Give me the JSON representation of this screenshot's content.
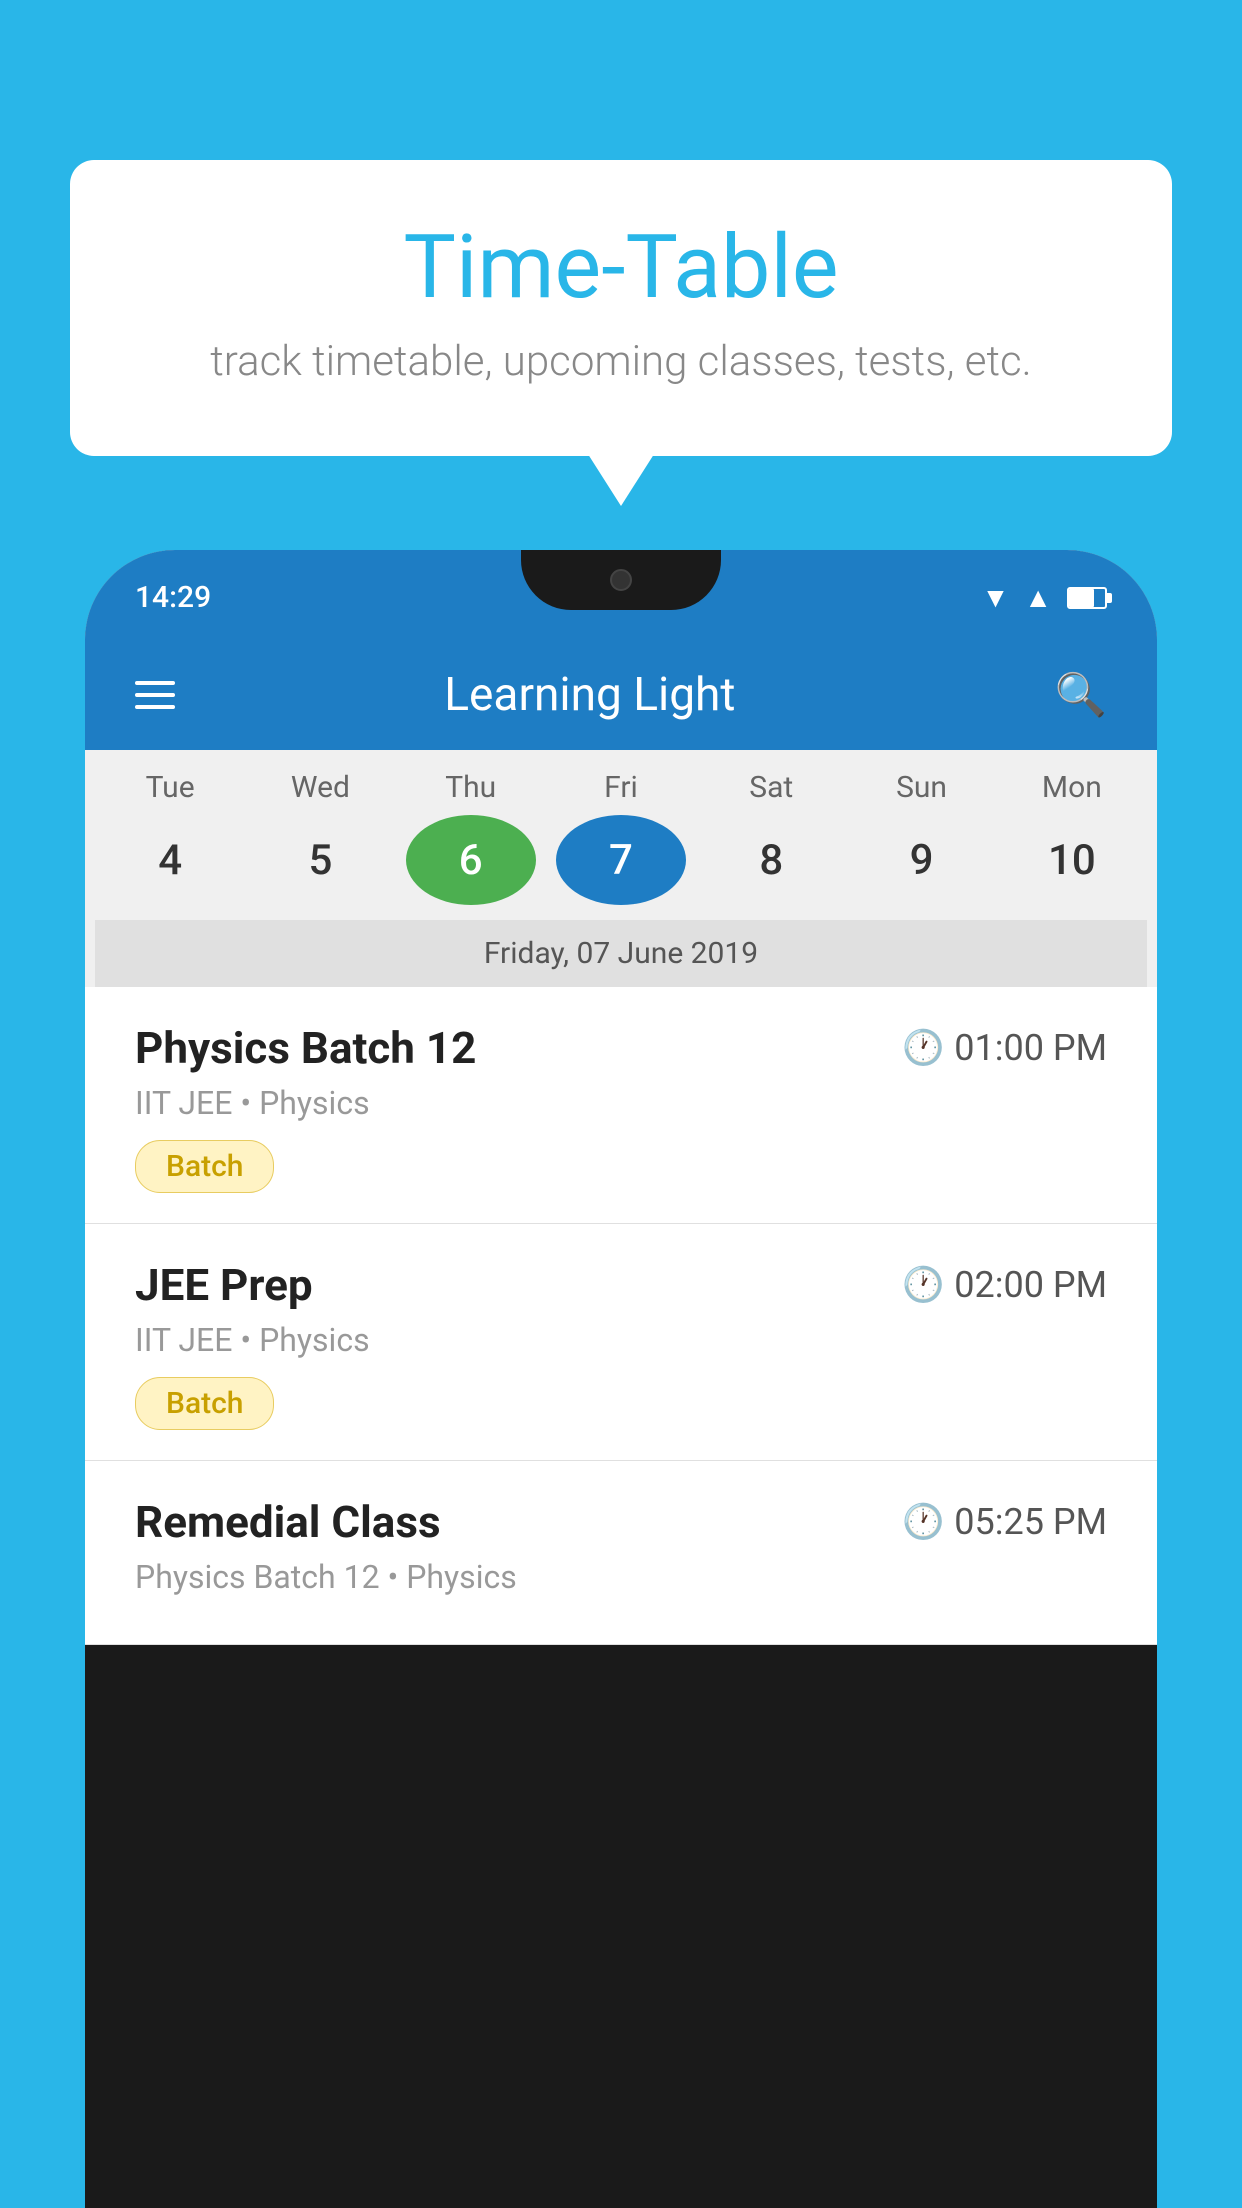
{
  "background_color": "#29b6e8",
  "speech_bubble": {
    "title": "Time-Table",
    "subtitle": "track timetable, upcoming classes, tests, etc."
  },
  "phone": {
    "status_bar": {
      "time": "14:29",
      "wifi_icon": "wifi",
      "signal_icon": "signal",
      "battery_icon": "battery"
    },
    "app_header": {
      "title": "Learning Light",
      "menu_icon": "menu",
      "search_icon": "search"
    },
    "calendar": {
      "days": [
        {
          "label": "Tue",
          "number": "4"
        },
        {
          "label": "Wed",
          "number": "5"
        },
        {
          "label": "Thu",
          "number": "6",
          "state": "today"
        },
        {
          "label": "Fri",
          "number": "7",
          "state": "selected"
        },
        {
          "label": "Sat",
          "number": "8"
        },
        {
          "label": "Sun",
          "number": "9"
        },
        {
          "label": "Mon",
          "number": "10"
        }
      ],
      "selected_date_label": "Friday, 07 June 2019"
    },
    "schedule": [
      {
        "title": "Physics Batch 12",
        "time": "01:00 PM",
        "subtitle": "IIT JEE • Physics",
        "badge": "Batch"
      },
      {
        "title": "JEE Prep",
        "time": "02:00 PM",
        "subtitle": "IIT JEE • Physics",
        "badge": "Batch"
      },
      {
        "title": "Remedial Class",
        "time": "05:25 PM",
        "subtitle": "Physics Batch 12 • Physics",
        "badge": ""
      }
    ]
  }
}
